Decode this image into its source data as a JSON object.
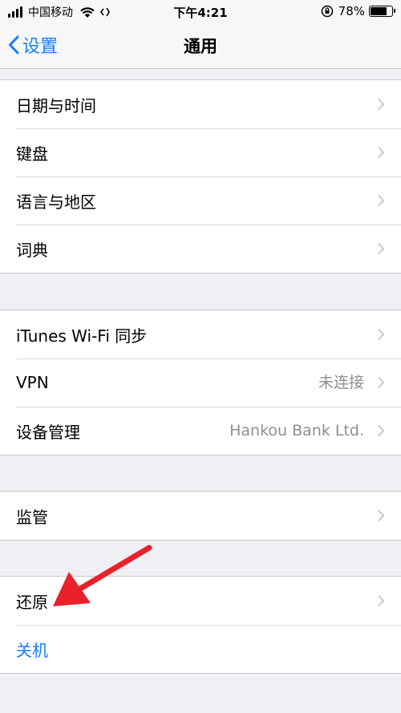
{
  "status": {
    "carrier": "中国移动",
    "time": "下午4:21",
    "battery": "78%",
    "battery_level": 0.78
  },
  "nav": {
    "back_label": "设置",
    "title": "通用"
  },
  "groups": [
    {
      "rows": [
        {
          "label": "日期与时间"
        },
        {
          "label": "键盘"
        },
        {
          "label": "语言与地区"
        },
        {
          "label": "词典"
        }
      ]
    },
    {
      "rows": [
        {
          "label": "iTunes Wi-Fi 同步"
        },
        {
          "label": "VPN",
          "value": "未连接"
        },
        {
          "label": "设备管理",
          "value": "Hankou Bank Ltd."
        }
      ]
    },
    {
      "rows": [
        {
          "label": "监管"
        }
      ]
    },
    {
      "rows": [
        {
          "label": "还原"
        },
        {
          "label": "关机"
        }
      ]
    }
  ],
  "colors": {
    "accent": "#157efb",
    "annotation_arrow": "#e8212b"
  }
}
